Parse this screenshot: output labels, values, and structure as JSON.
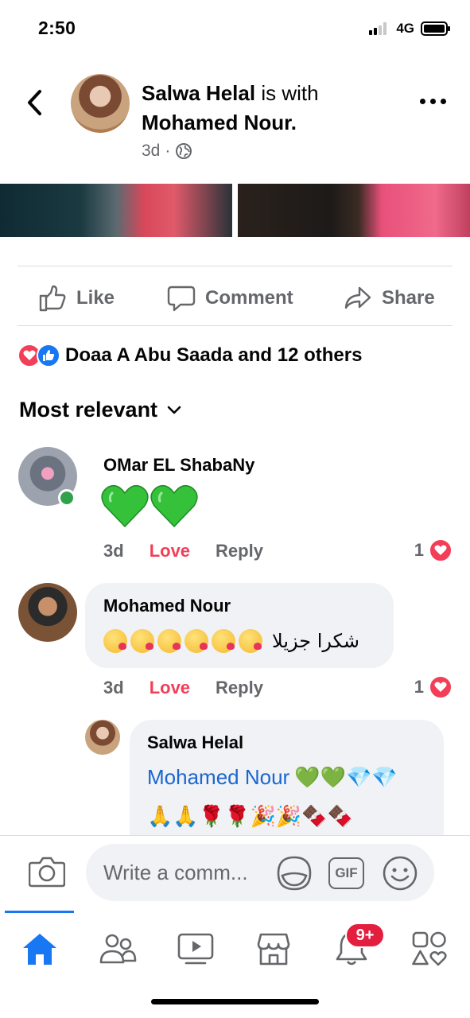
{
  "status_bar": {
    "time": "2:50",
    "network": "4G"
  },
  "post_header": {
    "author": "Salwa Helal",
    "with_text": "is with",
    "tagged": "Mohamed Nour.",
    "time": "3d",
    "separator": "·",
    "audience_icon": "globe-icon"
  },
  "actions": {
    "like": "Like",
    "comment": "Comment",
    "share": "Share"
  },
  "reactions_summary": {
    "text": "Doaa A Abu Saada and 12 others",
    "icons": [
      "love-reaction-icon",
      "like-reaction-icon"
    ]
  },
  "sort": {
    "label": "Most relevant"
  },
  "comments": [
    {
      "author": "OMar EL ShabaNy",
      "content_emoji": "💚💚",
      "time": "3d",
      "reaction": "Love",
      "reply": "Reply",
      "reaction_count": "1",
      "online": true
    },
    {
      "author": "Mohamed Nour",
      "text": "شكرا جزيلا",
      "emoji_count": 6,
      "time": "3d",
      "reaction": "Love",
      "reply": "Reply",
      "reaction_count": "1"
    },
    {
      "author": "Salwa Helal",
      "mention": "Mohamed Nour",
      "line1_emoji": "💚💚💎💎",
      "line2_emoji": "🙏🙏🌹🌹🎉🎉🍫🍫"
    }
  ],
  "composer": {
    "placeholder": "Write a comm...",
    "gif_label": "GIF"
  },
  "nav": {
    "items": [
      "home-icon",
      "friends-icon",
      "watch-icon",
      "marketplace-icon",
      "notifications-icon",
      "menu-icon"
    ],
    "notifications_badge": "9+",
    "active_color": "#1877f2"
  }
}
